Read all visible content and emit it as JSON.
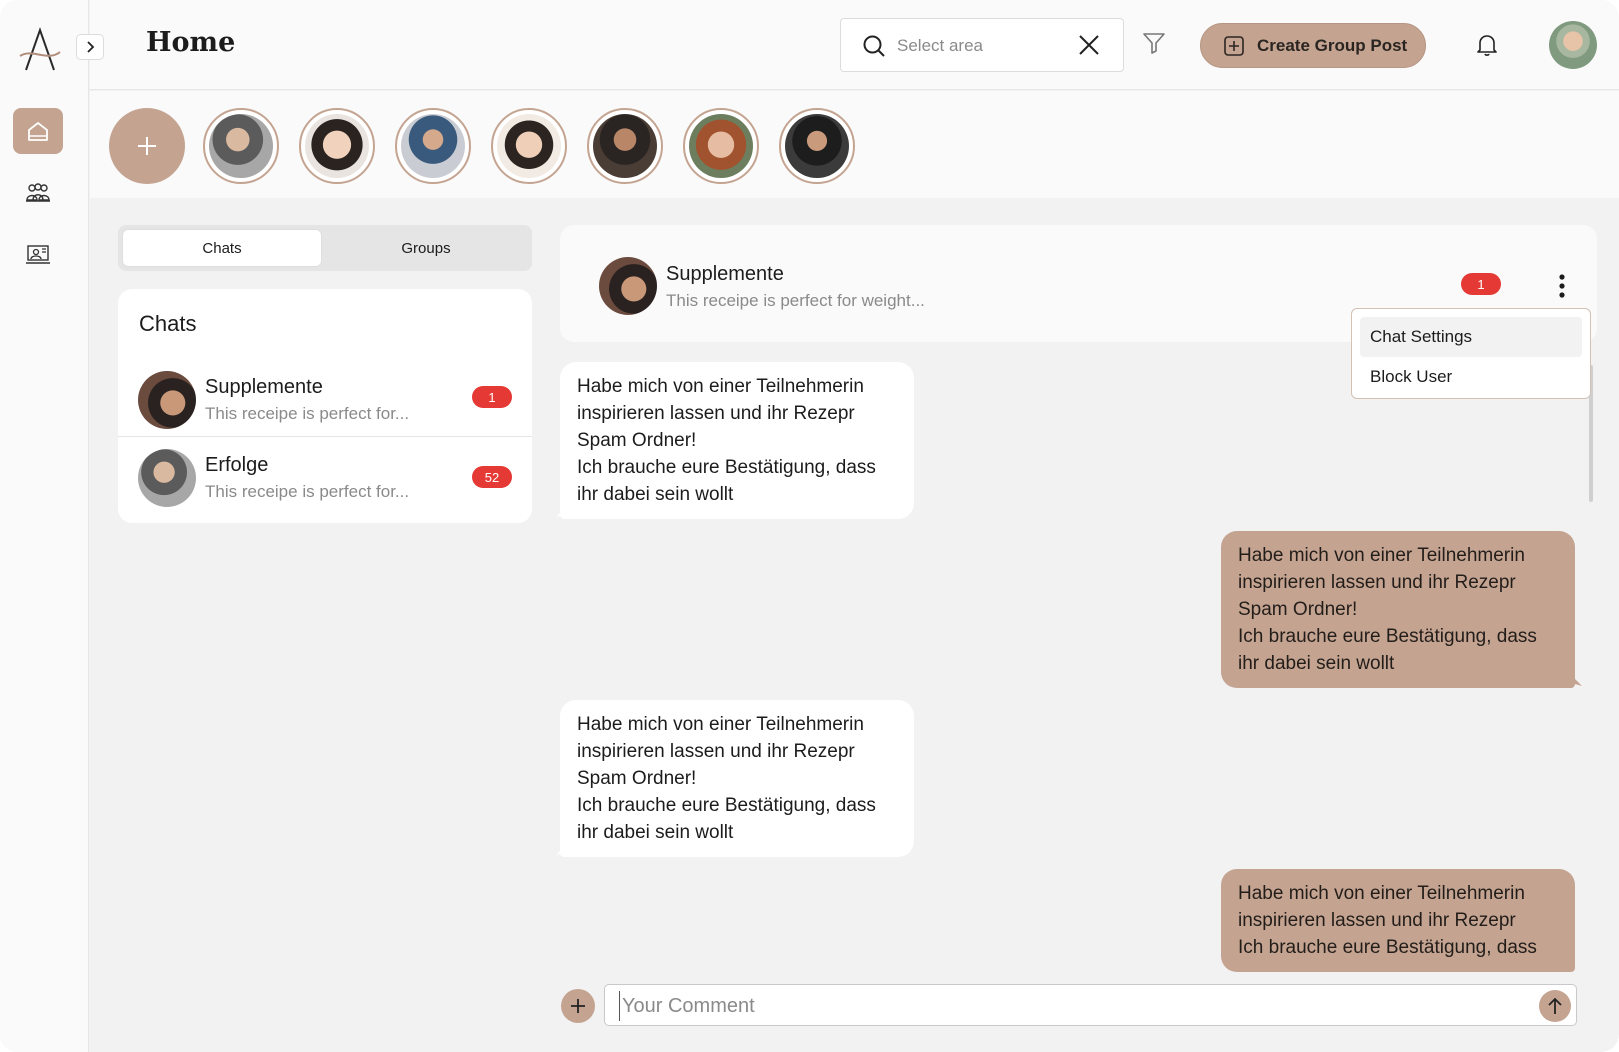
{
  "header": {
    "title": "Home",
    "search_placeholder": "Select area",
    "create_label": "Create Group Post"
  },
  "tabs": [
    {
      "label": "Chats",
      "active": true
    },
    {
      "label": "Groups",
      "active": false
    }
  ],
  "chat_list": {
    "title": "Chats",
    "items": [
      {
        "name": "Supplemente",
        "preview": "This receipe is perfect for...",
        "badge": "1"
      },
      {
        "name": "Erfolge",
        "preview": "This receipe is perfect for...",
        "badge": "52"
      }
    ]
  },
  "conversation": {
    "name": "Supplemente",
    "preview": "This receipe is perfect for weight...",
    "badge": "1",
    "menu": [
      "Chat Settings",
      "Block User"
    ],
    "messages": [
      {
        "direction": "in",
        "lines": [
          "Habe mich von einer Teilnehmerin",
          "inspirieren lassen und ihr Rezepr",
          "Spam Ordner!",
          "Ich brauche eure Bestätigung, dass",
          "ihr dabei sein wollt"
        ]
      },
      {
        "direction": "out",
        "lines": [
          "Habe mich von einer Teilnehmerin",
          "inspirieren lassen und ihr Rezepr",
          "Spam Ordner!",
          "Ich brauche eure Bestätigung, dass",
          "ihr dabei sein wollt"
        ]
      },
      {
        "direction": "in",
        "lines": [
          "Habe mich von einer Teilnehmerin",
          "inspirieren lassen und ihr Rezepr",
          "Spam Ordner!",
          "Ich brauche eure Bestätigung, dass",
          "ihr dabei sein wollt"
        ]
      },
      {
        "direction": "out",
        "lines": [
          "Habe mich von einer Teilnehmerin",
          "inspirieren lassen und ihr Rezepr",
          "Ich brauche eure Bestätigung, dass"
        ]
      }
    ]
  },
  "composer": {
    "placeholder": "Your Comment"
  },
  "icons": {
    "logo": "logo-a-icon",
    "expand": "chevron-right-icon",
    "nav": [
      "home-icon",
      "community-icon",
      "profile-board-icon"
    ],
    "search": "search-icon",
    "clear": "close-icon",
    "filter": "filter-icon",
    "create": "plus-square-icon",
    "notification": "bell-icon",
    "story_add": "plus-icon",
    "more": "kebab-icon",
    "attach": "plus-icon",
    "send": "arrow-up-icon"
  },
  "colors": {
    "accent": "#c4a491",
    "badge": "#e53935",
    "background": "#f2f2f2"
  }
}
